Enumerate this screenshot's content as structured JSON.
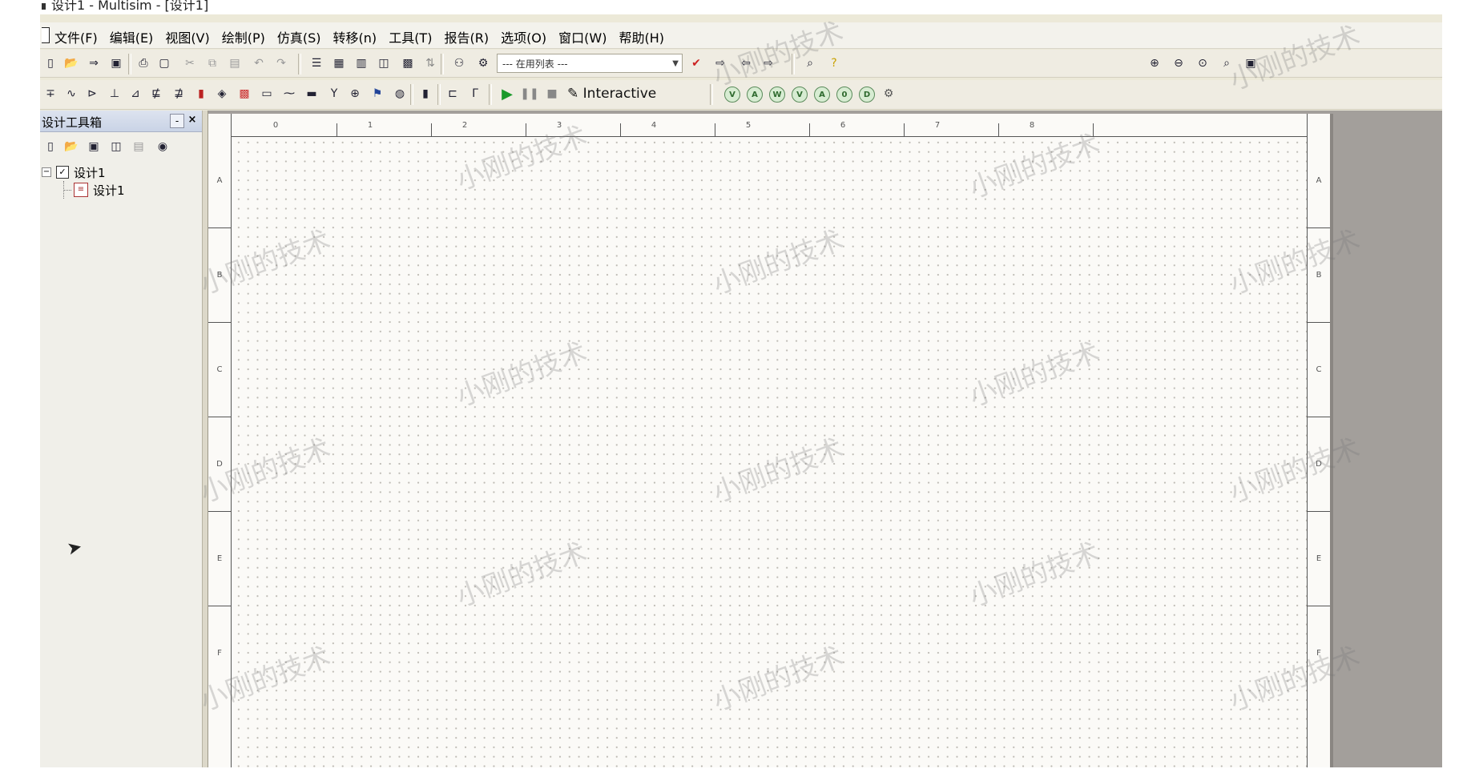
{
  "window": {
    "title": "设计1 - Multisim - [设计1]"
  },
  "menu": [
    "文件(F)",
    "编辑(E)",
    "视图(V)",
    "绘制(P)",
    "仿真(S)",
    "转移(n)",
    "工具(T)",
    "报告(R)",
    "选项(O)",
    "窗口(W)",
    "帮助(H)"
  ],
  "toolbar": {
    "in_use_list": "--- 在用列表 ---",
    "interactive_label": "Interactive",
    "icons": [
      "new-icon",
      "open-icon",
      "open-sample-icon",
      "save-icon",
      "print-icon",
      "print-preview-icon",
      "cut-icon",
      "copy-icon",
      "paste-icon",
      "undo-icon",
      "redo-icon",
      "design-toolbox-icon",
      "spreadsheet-icon",
      "grapher-icon",
      "postprocessor-icon",
      "database-manager-icon",
      "component-wizard-icon",
      "in-use-list-icon",
      "erc-icon",
      "back-annotate-icon",
      "forward-annotate-icon",
      "zoom-in-icon",
      "zoom-out-icon",
      "zoom-area-icon",
      "zoom-fit-icon",
      "full-screen-icon",
      "find-icon",
      "help-icon"
    ]
  },
  "toolbox": {
    "title": "设计工具箱",
    "pin": "-",
    "close": "×",
    "tree": {
      "root": "设计1",
      "child": "设计1"
    }
  },
  "sheet": {
    "columns": [
      "0",
      "1",
      "2",
      "3",
      "4",
      "5",
      "6",
      "7",
      "8"
    ],
    "rows": [
      "A",
      "B",
      "C",
      "D",
      "E",
      "F"
    ]
  },
  "watermark_text": "小刚的技术"
}
